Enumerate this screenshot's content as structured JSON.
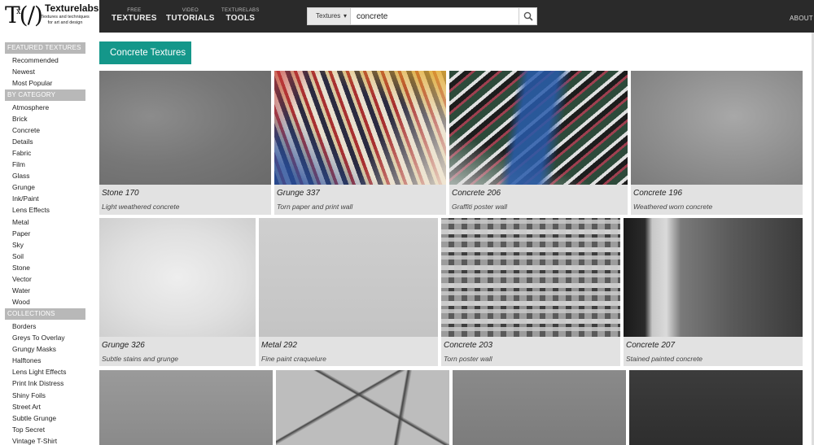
{
  "header": {
    "logo_mark": "T(/)",
    "logo_sup": "x",
    "logo_title": "Texturelabs",
    "logo_tagline": "Textures and techniques for art and design",
    "nav": [
      {
        "small": "FREE",
        "big": "TEXTURES"
      },
      {
        "small": "VIDEO",
        "big": "TUTORIALS"
      },
      {
        "small": "TEXTURELABS",
        "big": "TOOLS"
      }
    ],
    "search": {
      "category": "Textures",
      "value": "concrete"
    },
    "about": "ABOUT"
  },
  "sidebar": {
    "featured_head": "FEATURED TEXTURES",
    "featured": [
      "Recommended",
      "Newest",
      "Most Popular"
    ],
    "category_head": "BY CATEGORY",
    "categories": [
      "Atmosphere",
      "Brick",
      "Concrete",
      "Details",
      "Fabric",
      "Film",
      "Glass",
      "Grunge",
      "Ink/Paint",
      "Lens Effects",
      "Metal",
      "Paper",
      "Sky",
      "Soil",
      "Stone",
      "Vector",
      "Water",
      "Wood"
    ],
    "collections_head": "COLLECTIONS",
    "collections": [
      "Borders",
      "Greys To Overlay",
      "Grungy Masks",
      "Halftones",
      "Lens Light Effects",
      "Print Ink Distress",
      "Shiny Foils",
      "Street Art",
      "Subtle Grunge",
      "Top Secret",
      "Vintage T-Shirt"
    ]
  },
  "main": {
    "title": "Concrete Textures",
    "cards": [
      {
        "title": "Stone 170",
        "subtitle": "Light weathered concrete"
      },
      {
        "title": "Grunge 337",
        "subtitle": "Torn paper and print wall"
      },
      {
        "title": "Concrete 206",
        "subtitle": "Graffiti poster wall"
      },
      {
        "title": "Concrete 196",
        "subtitle": "Weathered worn concrete"
      },
      {
        "title": "Grunge 326",
        "subtitle": "Subtle stains and grunge"
      },
      {
        "title": "Metal 292",
        "subtitle": "Fine paint craquelure"
      },
      {
        "title": "Concrete 203",
        "subtitle": "Torn poster wall"
      },
      {
        "title": "Concrete 207",
        "subtitle": "Stained painted concrete"
      }
    ]
  },
  "colors": {
    "accent": "#14978a",
    "header_bg": "#2a2a2a",
    "section_head": "#b8b8b8",
    "card_bg": "#e2e2e2"
  }
}
